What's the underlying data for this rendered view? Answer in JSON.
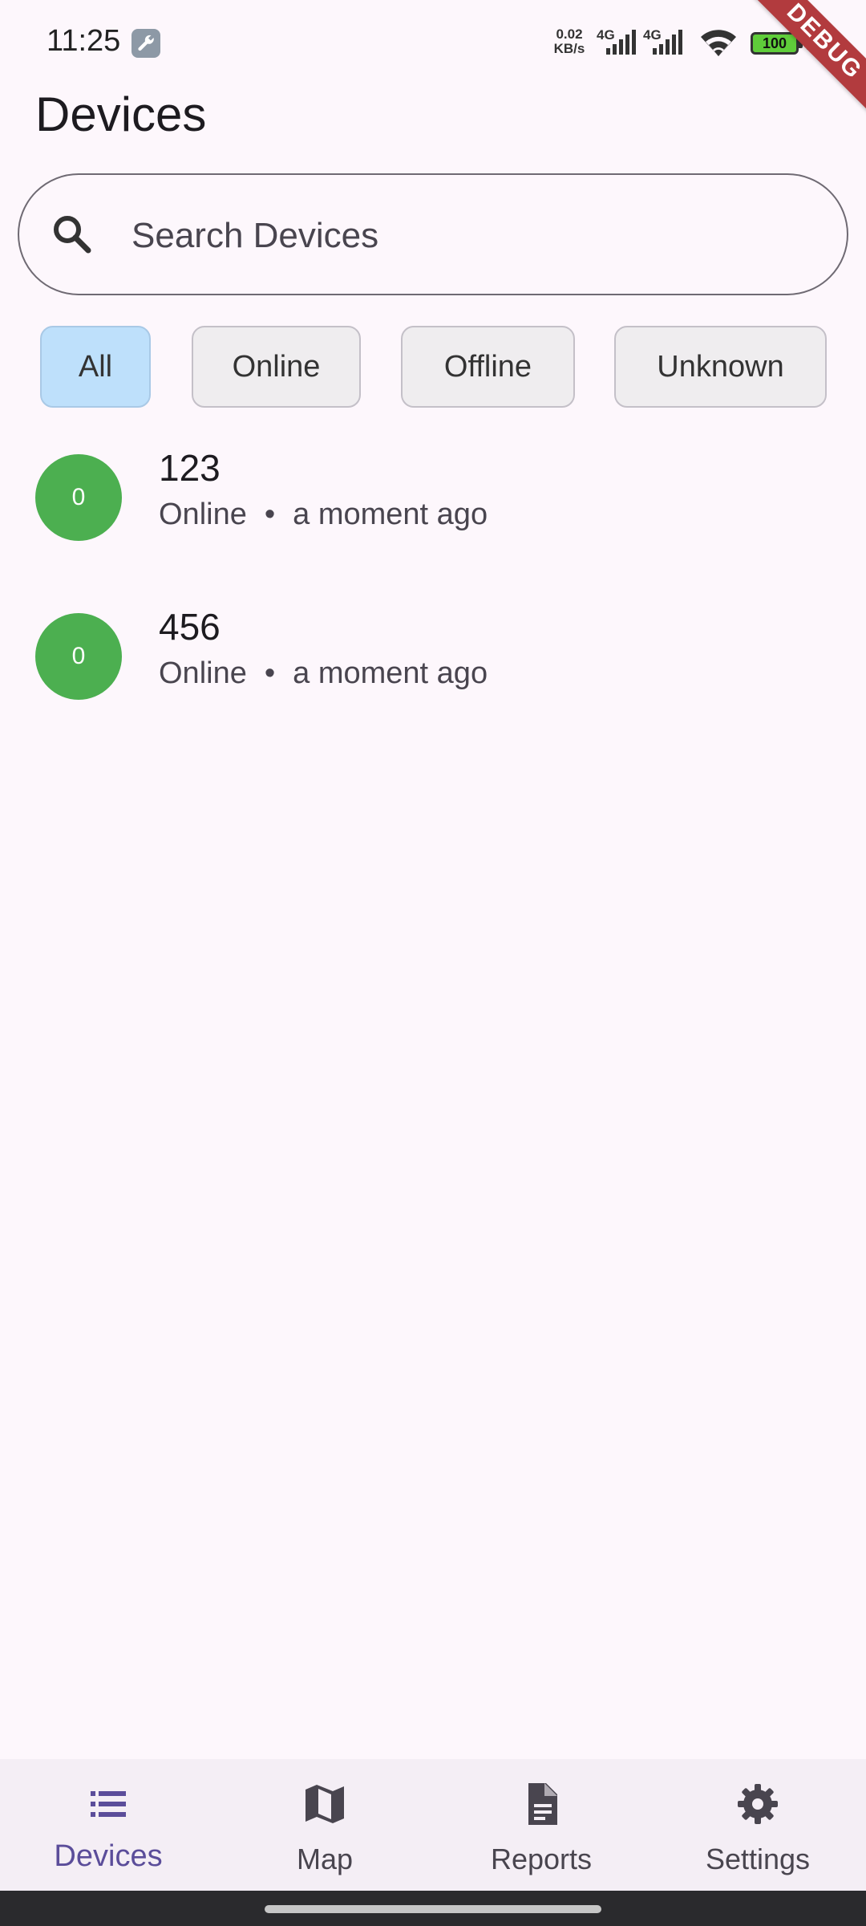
{
  "status_bar": {
    "time": "11:25",
    "net_speed_value": "0.02",
    "net_speed_unit": "KB/s",
    "sim1": "4G",
    "sim2": "4G",
    "battery_level": "100",
    "debug_label": "DEBUG"
  },
  "header": {
    "title": "Devices"
  },
  "search": {
    "placeholder": "Search Devices",
    "value": ""
  },
  "filters": [
    {
      "label": "All",
      "selected": true
    },
    {
      "label": "Online",
      "selected": false
    },
    {
      "label": "Offline",
      "selected": false
    },
    {
      "label": "Unknown",
      "selected": false
    }
  ],
  "devices": [
    {
      "avatar": "0",
      "name": "123",
      "status": "Online",
      "last_seen": "a moment ago",
      "avatar_color": "#4caf50"
    },
    {
      "avatar": "0",
      "name": "456",
      "status": "Online",
      "last_seen": "a moment ago",
      "avatar_color": "#4caf50"
    }
  ],
  "bottom_nav": [
    {
      "label": "Devices",
      "icon": "list-icon",
      "active": true
    },
    {
      "label": "Map",
      "icon": "map-icon",
      "active": false
    },
    {
      "label": "Reports",
      "icon": "document-icon",
      "active": false
    },
    {
      "label": "Settings",
      "icon": "gear-icon",
      "active": false
    }
  ],
  "colors": {
    "background": "#fdf7fc",
    "accent": "#5b4d9a",
    "chip_selected": "#bee0fb",
    "online": "#4caf50",
    "debug_banner": "#b23b3e"
  }
}
